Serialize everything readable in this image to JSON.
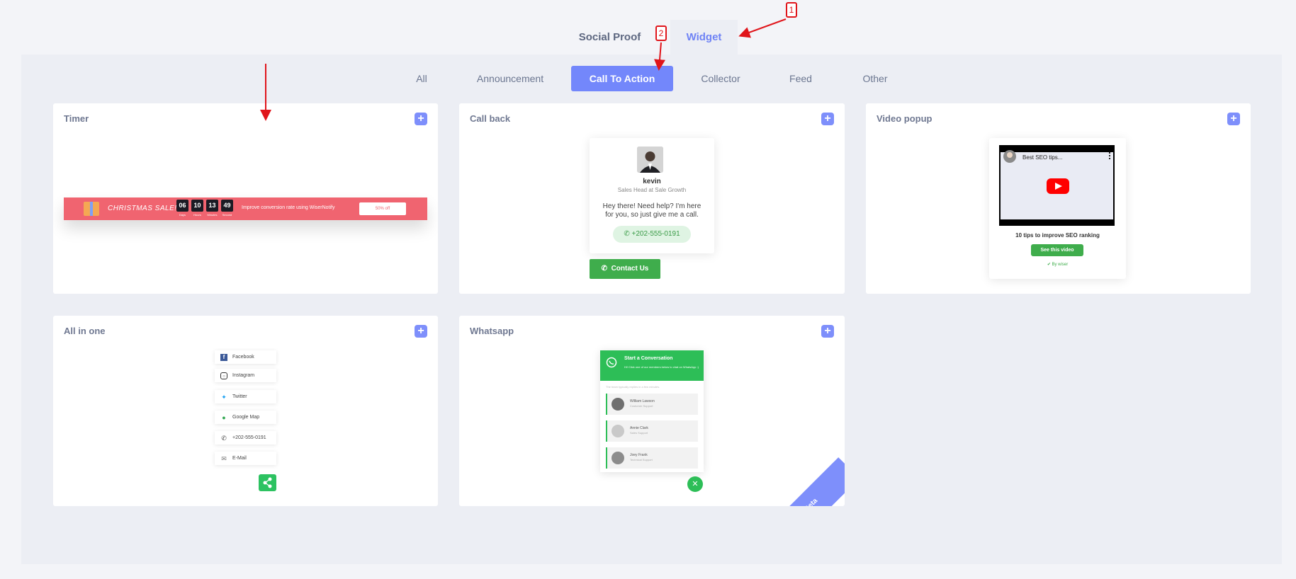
{
  "top_tabs": {
    "social_proof": "Social Proof",
    "widget": "Widget"
  },
  "filters": [
    "All",
    "Announcement",
    "Call To Action",
    "Collector",
    "Feed",
    "Other"
  ],
  "cards": {
    "timer": {
      "title": "Timer",
      "sale_label": "CHRISTMAS SALE!",
      "countdown": [
        {
          "value": "06",
          "label": "Days"
        },
        {
          "value": "10",
          "label": "Hours"
        },
        {
          "value": "13",
          "label": "Minutes"
        },
        {
          "value": "49",
          "label": "Second"
        }
      ],
      "message": "Improve conversion rate using WiserNotify",
      "button": "50% off"
    },
    "call_back": {
      "title": "Call back",
      "name": "kevin",
      "role": "Sales Head at Sale Growth",
      "message": "Hey there! Need help? I'm here for you, so just give me a call.",
      "phone": "+202-555-0191",
      "contact_button": "Contact Us"
    },
    "video_popup": {
      "title": "Video popup",
      "video_title": "Best SEO tips...",
      "caption": "10 tips to improve SEO ranking",
      "button": "See this video",
      "by": "By wiser"
    },
    "all_in_one": {
      "title": "All in one",
      "items": [
        "Facebook",
        "Instagram",
        "Twitter",
        "Google Map",
        "+202-555-0191",
        "E-Mail"
      ]
    },
    "whatsapp": {
      "title": "Whatsapp",
      "header_title": "Start a Conversation",
      "header_sub": "Hi! Click one of our members below to chat on WhatsApp :)",
      "reply_note": "The team typically replies in a few minutes.",
      "members": [
        {
          "name": "William Lawson",
          "role": "Customer Support"
        },
        {
          "name": "Annie Clark",
          "role": "Sales Support"
        },
        {
          "name": "Joey Frank",
          "role": "Technical Support"
        }
      ],
      "badge": "Beta"
    }
  },
  "annotations": [
    "1",
    "2"
  ],
  "colors": {
    "accent": "#7387fb",
    "green": "#3fad4c",
    "timer_bar": "#f06470",
    "arrow": "#e0151b"
  }
}
